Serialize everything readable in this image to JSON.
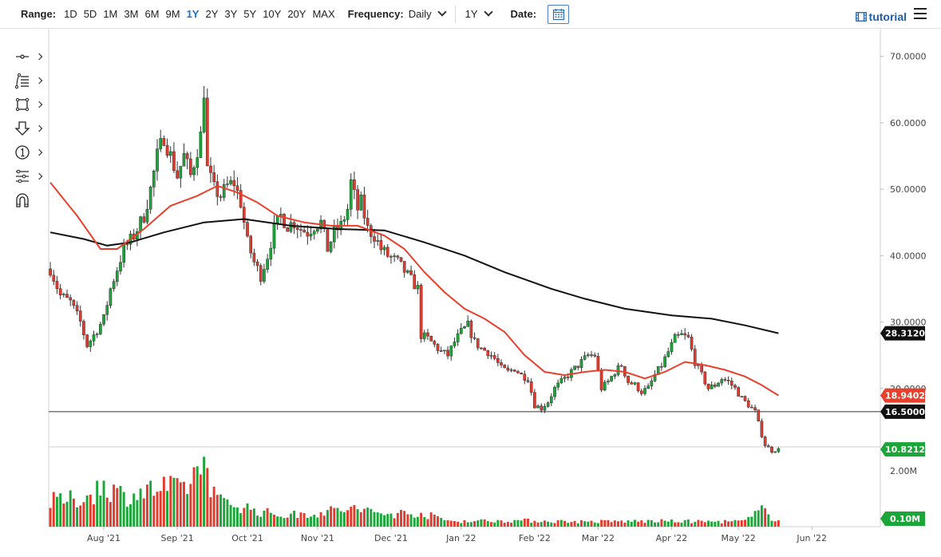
{
  "toolbar": {
    "range_label": "Range:",
    "ranges": [
      "1D",
      "5D",
      "1M",
      "3M",
      "6M",
      "9M",
      "1Y",
      "2Y",
      "3Y",
      "5Y",
      "10Y",
      "20Y",
      "MAX"
    ],
    "active_range": "1Y",
    "frequency_label": "Frequency:",
    "frequency_value": "Daily",
    "period_value": "1Y",
    "date_label": "Date:",
    "tutorial_label": "tutorial"
  },
  "left_tools": [
    "crosshair-tool-icon",
    "fib-lines-tool-icon",
    "rectangle-tool-icon",
    "arrow-down-tool-icon",
    "numbered-marker-tool-icon",
    "sliders-tool-icon",
    "magnet-tool-icon"
  ],
  "colors": {
    "up": "#1ca63a",
    "down": "#e23b2e",
    "ma_fast": "#e8402c",
    "ma_slow": "#111111",
    "price_tag": "#1ca63a",
    "ma_fast_tag": "#e8402c",
    "ma_slow_tag": "#111111",
    "level_tag": "#111111"
  },
  "chart_data": {
    "type": "candlestick",
    "y_ticks": [
      "70.0000",
      "60.0000",
      "50.0000",
      "40.0000",
      "30.0000",
      "20.0000"
    ],
    "ylim": [
      11.2,
      73.2
    ],
    "x_ticks": [
      {
        "label": "Aug '21",
        "i": 16
      },
      {
        "label": "Sep '21",
        "i": 38
      },
      {
        "label": "Oct '21",
        "i": 59
      },
      {
        "label": "Nov '21",
        "i": 80
      },
      {
        "label": "Dec '21",
        "i": 102
      },
      {
        "label": "Jan '22",
        "i": 123
      },
      {
        "label": "Feb '22",
        "i": 145
      },
      {
        "label": "Mar '22",
        "i": 164
      },
      {
        "label": "Apr '22",
        "i": 186
      },
      {
        "label": "May '22",
        "i": 206
      },
      {
        "label": "Jun '22",
        "i": 228
      }
    ],
    "n_slots": 249,
    "close_path": [
      [
        0,
        38.0
      ],
      [
        3,
        34.0
      ],
      [
        6,
        33.0
      ],
      [
        9,
        30.0
      ],
      [
        11,
        26.5
      ],
      [
        13,
        28.0
      ],
      [
        16,
        30.5
      ],
      [
        18,
        35.0
      ],
      [
        20,
        38.0
      ],
      [
        22,
        41.0
      ],
      [
        25,
        43.0
      ],
      [
        28,
        46.0
      ],
      [
        30,
        50.0
      ],
      [
        32,
        55.0
      ],
      [
        34,
        58.0
      ],
      [
        36,
        55.0
      ],
      [
        38,
        52.0
      ],
      [
        40,
        55.0
      ],
      [
        42,
        52.0
      ],
      [
        44,
        56.0
      ],
      [
        45,
        58.0
      ],
      [
        46,
        65.0
      ],
      [
        47,
        53.0
      ],
      [
        49,
        50.0
      ],
      [
        51,
        49.0
      ],
      [
        53,
        50.5
      ],
      [
        55,
        51.0
      ],
      [
        57,
        48.0
      ],
      [
        59,
        42.0
      ],
      [
        61,
        39.0
      ],
      [
        63,
        37.0
      ],
      [
        65,
        40.0
      ],
      [
        67,
        44.0
      ],
      [
        69,
        46.0
      ],
      [
        71,
        44.5
      ],
      [
        73,
        45.0
      ],
      [
        75,
        44.0
      ],
      [
        77,
        43.5
      ],
      [
        79,
        44.5
      ],
      [
        81,
        45.0
      ],
      [
        83,
        41.0
      ],
      [
        85,
        43.5
      ],
      [
        87,
        44.5
      ],
      [
        89,
        47.0
      ],
      [
        90,
        51.0
      ],
      [
        92,
        47.0
      ],
      [
        93,
        48.0
      ],
      [
        95,
        44.0
      ],
      [
        97,
        43.0
      ],
      [
        99,
        41.0
      ],
      [
        101,
        40.0
      ],
      [
        104,
        39.0
      ],
      [
        107,
        37.0
      ],
      [
        110,
        35.0
      ],
      [
        111,
        28.0
      ],
      [
        113,
        27.5
      ],
      [
        115,
        26.5
      ],
      [
        117,
        25.5
      ],
      [
        119,
        25.0
      ],
      [
        121,
        27.0
      ],
      [
        123,
        28.5
      ],
      [
        125,
        29.5
      ],
      [
        127,
        27.0
      ],
      [
        129,
        26.0
      ],
      [
        131,
        25.5
      ],
      [
        133,
        24.5
      ],
      [
        135,
        23.0
      ],
      [
        137,
        22.5
      ],
      [
        139,
        23.0
      ],
      [
        141,
        22.0
      ],
      [
        143,
        21.5
      ],
      [
        145,
        17.5
      ],
      [
        147,
        17.0
      ],
      [
        149,
        18.0
      ],
      [
        151,
        20.0
      ],
      [
        153,
        21.0
      ],
      [
        155,
        22.0
      ],
      [
        157,
        23.0
      ],
      [
        159,
        24.0
      ],
      [
        161,
        25.0
      ],
      [
        163,
        25.0
      ],
      [
        165,
        20.0
      ],
      [
        167,
        21.0
      ],
      [
        169,
        22.5
      ],
      [
        171,
        23.5
      ],
      [
        173,
        21.0
      ],
      [
        175,
        20.5
      ],
      [
        177,
        19.5
      ],
      [
        179,
        20.0
      ],
      [
        181,
        22.0
      ],
      [
        183,
        23.5
      ],
      [
        185,
        25.5
      ],
      [
        187,
        27.5
      ],
      [
        189,
        28.0
      ],
      [
        191,
        27.5
      ],
      [
        193,
        24.0
      ],
      [
        195,
        22.0
      ],
      [
        197,
        20.0
      ],
      [
        199,
        20.5
      ],
      [
        201,
        21.5
      ],
      [
        203,
        21.0
      ],
      [
        205,
        20.0
      ],
      [
        207,
        18.5
      ],
      [
        209,
        17.5
      ],
      [
        211,
        16.5
      ],
      [
        213,
        13.0
      ],
      [
        214,
        11.5
      ],
      [
        216,
        10.6
      ],
      [
        218,
        10.8
      ]
    ],
    "volume_ticks": [
      "2.00M",
      "0.10M"
    ],
    "volume_max_m": 2.5,
    "volume_profile": [
      [
        0,
        0.9
      ],
      [
        10,
        1.0
      ],
      [
        16,
        1.5
      ],
      [
        22,
        1.1
      ],
      [
        34,
        1.4
      ],
      [
        38,
        1.3
      ],
      [
        42,
        1.6
      ],
      [
        46,
        2.4
      ],
      [
        50,
        0.9
      ],
      [
        56,
        0.8
      ],
      [
        62,
        0.55
      ],
      [
        70,
        0.4
      ],
      [
        80,
        0.5
      ],
      [
        90,
        0.65
      ],
      [
        100,
        0.45
      ],
      [
        110,
        0.5
      ],
      [
        120,
        0.2
      ],
      [
        140,
        0.22
      ],
      [
        160,
        0.18
      ],
      [
        180,
        0.2
      ],
      [
        200,
        0.18
      ],
      [
        208,
        0.2
      ],
      [
        212,
        0.5
      ],
      [
        214,
        1.0
      ],
      [
        216,
        0.3
      ],
      [
        218,
        0.2
      ]
    ],
    "volume_up_bias": 0.5,
    "ma_fast": {
      "label": "18.9402",
      "points": [
        [
          0,
          51.0
        ],
        [
          8,
          46.0
        ],
        [
          15,
          41.0
        ],
        [
          20,
          41.0
        ],
        [
          28,
          44.0
        ],
        [
          36,
          47.5
        ],
        [
          44,
          49.0
        ],
        [
          50,
          50.5
        ],
        [
          56,
          49.5
        ],
        [
          62,
          48.0
        ],
        [
          68,
          46.0
        ],
        [
          76,
          45.0
        ],
        [
          84,
          44.5
        ],
        [
          92,
          44.5
        ],
        [
          100,
          43.0
        ],
        [
          106,
          41.0
        ],
        [
          112,
          37.5
        ],
        [
          118,
          34.5
        ],
        [
          124,
          32.0
        ],
        [
          130,
          30.5
        ],
        [
          136,
          28.5
        ],
        [
          142,
          25.0
        ],
        [
          148,
          22.5
        ],
        [
          154,
          22.0
        ],
        [
          160,
          22.5
        ],
        [
          166,
          22.8
        ],
        [
          172,
          22.5
        ],
        [
          178,
          21.5
        ],
        [
          184,
          22.5
        ],
        [
          190,
          24.0
        ],
        [
          196,
          23.5
        ],
        [
          202,
          22.8
        ],
        [
          208,
          21.8
        ],
        [
          213,
          20.5
        ],
        [
          218,
          18.94
        ]
      ]
    },
    "ma_slow": {
      "label": "28.3120",
      "points": [
        [
          0,
          43.5
        ],
        [
          10,
          42.5
        ],
        [
          17,
          41.5
        ],
        [
          24,
          42.0
        ],
        [
          34,
          43.5
        ],
        [
          46,
          45.0
        ],
        [
          58,
          45.5
        ],
        [
          72,
          44.5
        ],
        [
          86,
          44.0
        ],
        [
          100,
          43.8
        ],
        [
          112,
          42.0
        ],
        [
          124,
          40.0
        ],
        [
          136,
          37.5
        ],
        [
          150,
          35.0
        ],
        [
          160,
          33.5
        ],
        [
          172,
          32.0
        ],
        [
          186,
          31.0
        ],
        [
          198,
          30.5
        ],
        [
          208,
          29.5
        ],
        [
          218,
          28.31
        ]
      ]
    },
    "level_line": {
      "value": 16.5,
      "label": "16.5000"
    },
    "last_price": {
      "value": 10.8212,
      "label": "10.8212"
    }
  }
}
